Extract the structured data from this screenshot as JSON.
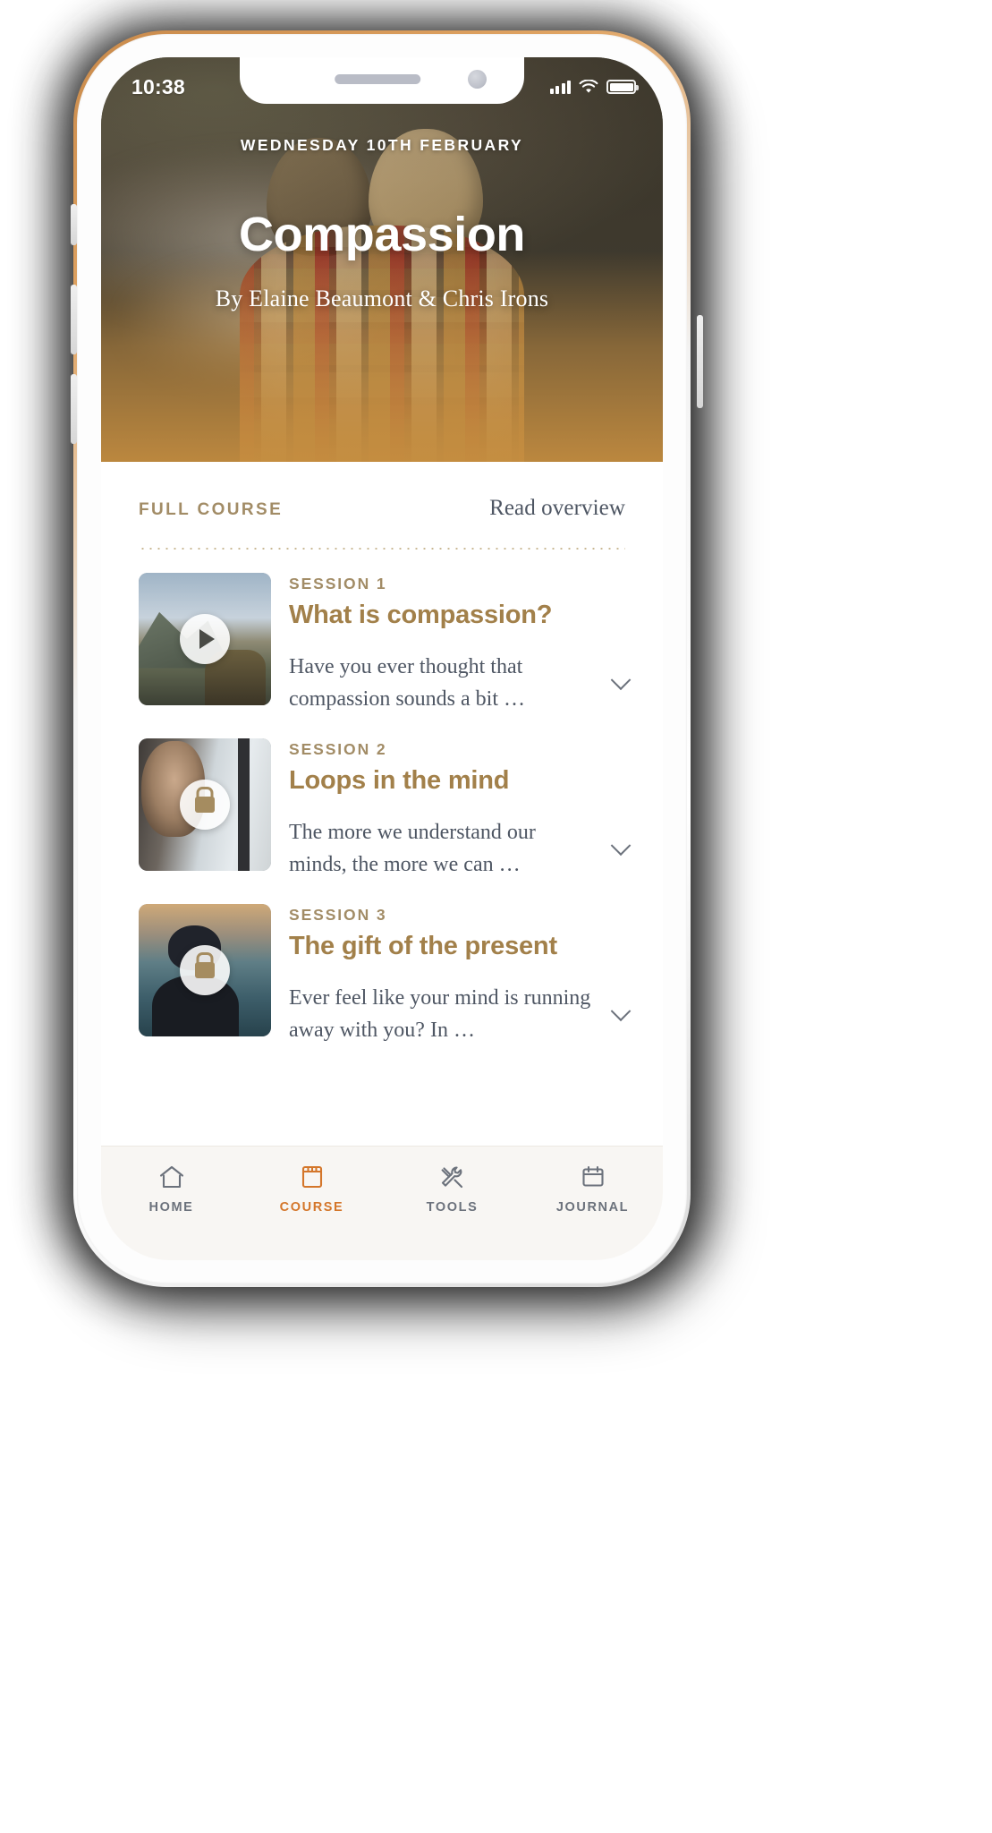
{
  "status_bar": {
    "time": "10:38",
    "signal_icon": "cellular-signal-icon",
    "wifi_icon": "wifi-icon",
    "battery_icon": "battery-full-icon"
  },
  "hero": {
    "date": "WEDNESDAY 10TH FEBRUARY",
    "title": "Compassion",
    "byline": "By Elaine Beaumont & Chris Irons"
  },
  "course": {
    "section_label": "FULL COURSE",
    "overview_link": "Read overview",
    "sessions": [
      {
        "kicker": "SESSION 1",
        "title": "What is compassion?",
        "description": "Have you ever thought that compassion sounds a bit …",
        "state": "unlocked",
        "badge_icon": "play-icon",
        "expand_icon": "chevron-down-icon"
      },
      {
        "kicker": "SESSION 2",
        "title": "Loops in the mind",
        "description": "The more we understand our minds, the more we can …",
        "state": "locked",
        "badge_icon": "lock-icon",
        "expand_icon": "chevron-down-icon"
      },
      {
        "kicker": "SESSION 3",
        "title": "The gift of the present",
        "description": "Ever feel like your mind is running away with you? In …",
        "state": "locked",
        "badge_icon": "lock-icon",
        "expand_icon": "chevron-down-icon"
      }
    ]
  },
  "tabbar": {
    "items": [
      {
        "label": "HOME",
        "icon": "home-icon",
        "active": false
      },
      {
        "label": "COURSE",
        "icon": "book-icon",
        "active": true
      },
      {
        "label": "TOOLS",
        "icon": "tools-icon",
        "active": false
      },
      {
        "label": "JOURNAL",
        "icon": "calendar-icon",
        "active": false
      }
    ]
  },
  "colors": {
    "accent_gold": "#A2804A",
    "label_tan": "#A28C66",
    "active_tab": "#D4762A",
    "body_text": "#4E5663",
    "tabbar_bg": "#F8F6F3"
  }
}
